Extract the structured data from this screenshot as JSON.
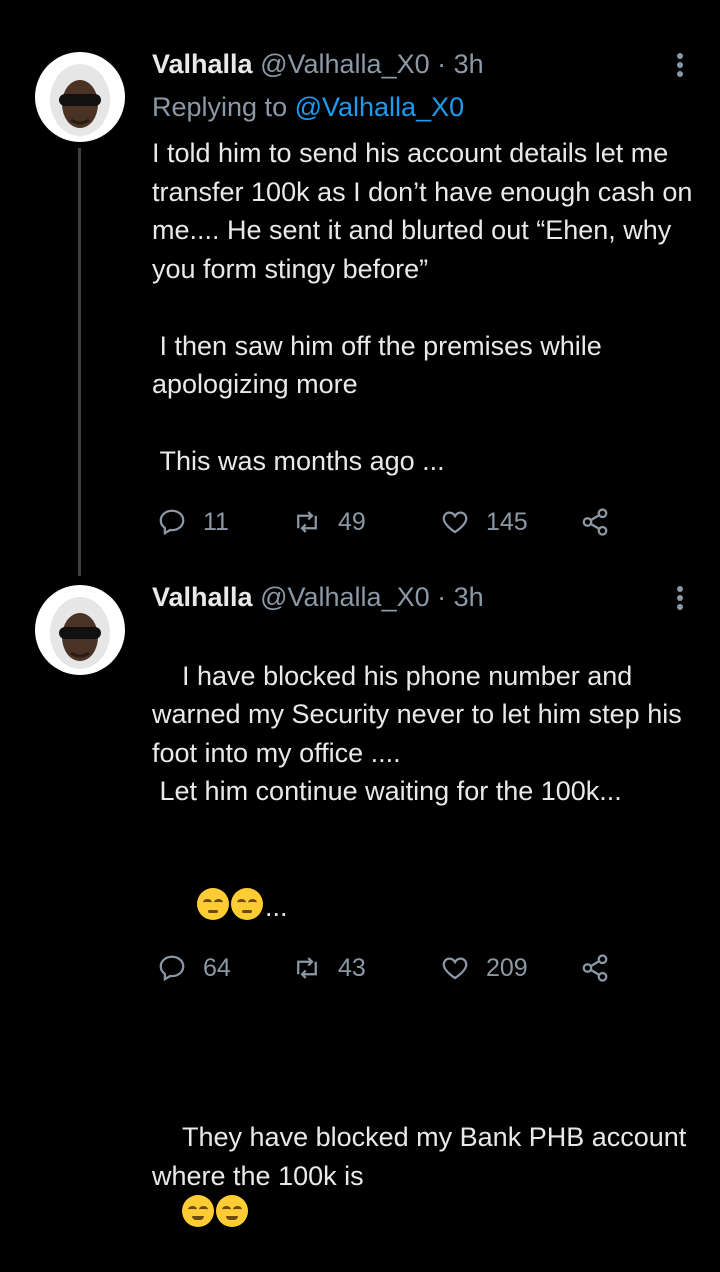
{
  "tweets": [
    {
      "name": "Valhalla",
      "handle": "@Valhalla_X0",
      "dot": "·",
      "time": "3h",
      "replying_prefix": "Replying to ",
      "replying_handle": "@Valhalla_X0",
      "body": "I told him to send his account details let me transfer 100k as I don’t have enough cash on me.... He sent it and blurted out “Ehen, why you form stingy before”\n\n I then saw him off the premises while apologizing more\n\n This was months ago ...",
      "replies": "11",
      "retweets": "49",
      "likes": "145"
    },
    {
      "name": "Valhalla",
      "handle": "@Valhalla_X0",
      "dot": "·",
      "time": "3h",
      "body_main": "I have blocked his phone number and warned my Security never to let him step his foot into my office ....\n Let him continue waiting for the 100k...",
      "emoji_line_suffix": "...",
      "body_tail": "They have blocked my Bank PHB account where the 100k is",
      "replies": "64",
      "retweets": "43",
      "likes": "209"
    }
  ],
  "icons": {
    "reply": "reply-icon",
    "retweet": "retweet-icon",
    "like": "heart-icon",
    "share": "share-icon",
    "more": "more-vertical-icon"
  },
  "colors": {
    "background": "#000000",
    "text": "#e7e9ea",
    "muted": "#8b98a5",
    "link": "#1d9bf0",
    "thread_line": "#3e4144"
  }
}
